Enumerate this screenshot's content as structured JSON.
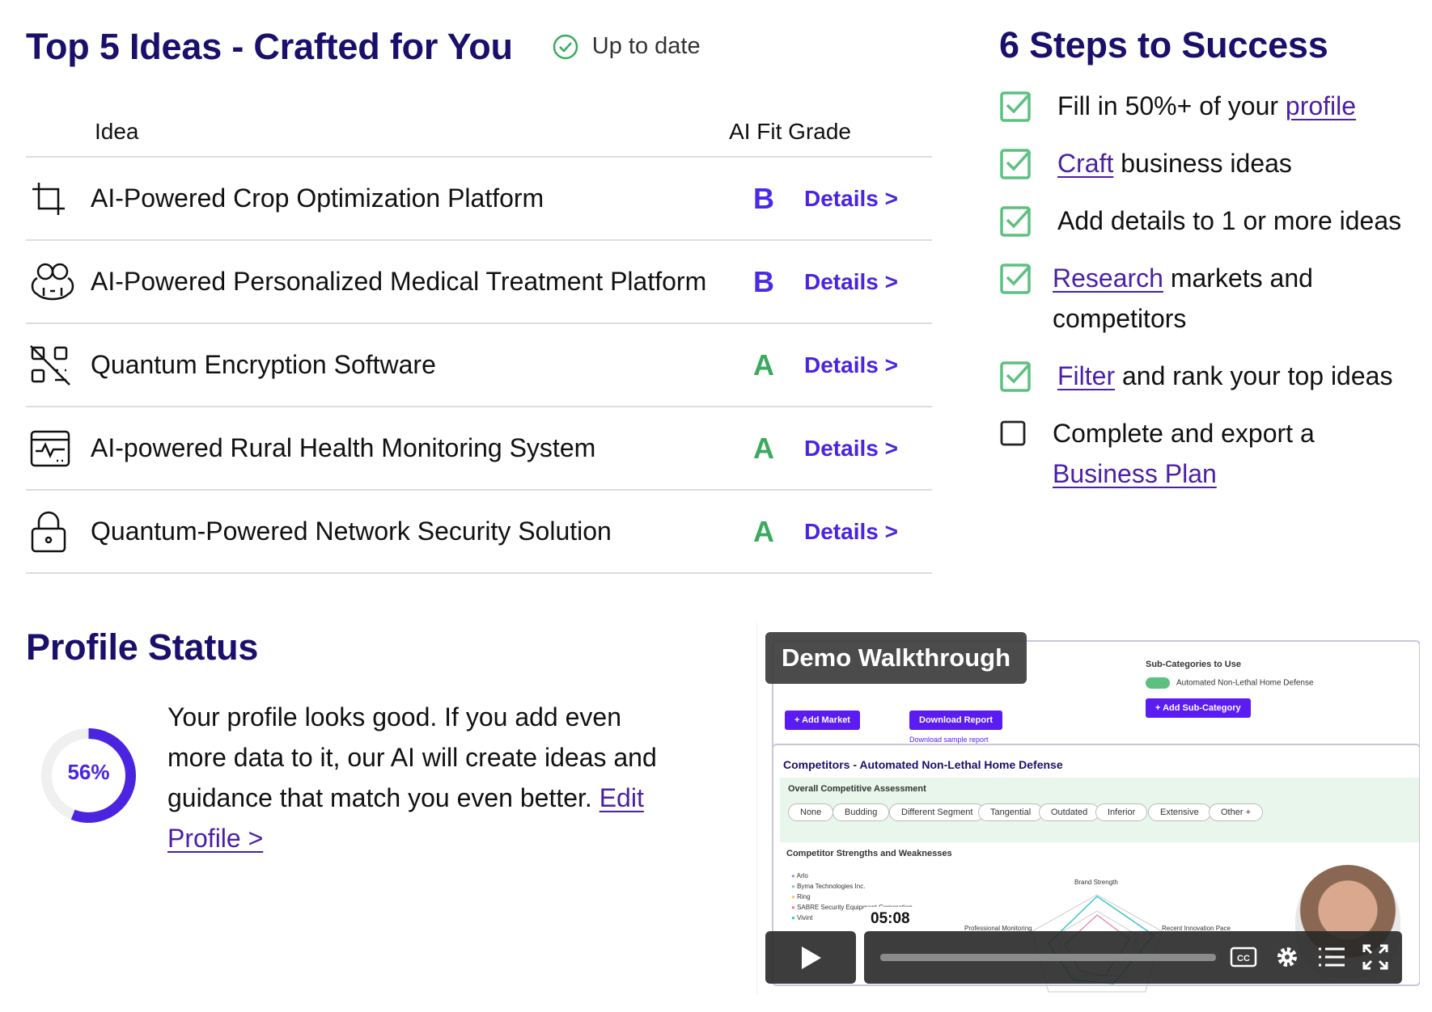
{
  "ideas": {
    "title": "Top 5 Ideas - Crafted for You",
    "status": "Up to date",
    "col_idea": "Idea",
    "col_grade": "AI Fit Grade",
    "rows": [
      {
        "name": "AI-Powered Crop Optimization Platform",
        "grade": "B",
        "details": "Details >",
        "icon": "crop-icon"
      },
      {
        "name": "AI-Powered Personalized Medical Treatment Platform",
        "grade": "B",
        "details": "Details >",
        "icon": "medical-mask-icon"
      },
      {
        "name": "Quantum Encryption Software",
        "grade": "A",
        "details": "Details >",
        "icon": "qr-off-icon"
      },
      {
        "name": "AI-powered Rural Health Monitoring System",
        "grade": "A",
        "details": "Details >",
        "icon": "health-monitor-icon"
      },
      {
        "name": "Quantum-Powered Network Security Solution",
        "grade": "A",
        "details": "Details >",
        "icon": "lock-icon"
      }
    ]
  },
  "steps": {
    "title": "6 Steps to Success",
    "s1_pre": "Fill in 50%+ of your ",
    "s1_link": "profile",
    "s2_link": "Craft",
    "s2_post": " business ideas",
    "s3": "Add details to 1 or more ideas",
    "s4_link": "Research",
    "s4_post": " markets and competitors",
    "s5_link": "Filter",
    "s5_post": " and rank your top ideas",
    "s6_pre": "Complete and export a ",
    "s6_link": "Business Plan"
  },
  "profile": {
    "title": "Profile Status",
    "percent_label": "56%",
    "percent": 56,
    "text": "Your profile looks good. If you add even more data to it, our AI will create ideas and guidance that match you even better. ",
    "link": "Edit Profile >"
  },
  "video": {
    "label": "Demo Walkthrough",
    "time": "05:08",
    "sub_categories": "Sub-Categories to Use",
    "toggle_label": "Automated Non-Lethal Home Defense",
    "add_sub": "+ Add Sub-Category",
    "add_market": "+ Add Market",
    "download": "Download Report",
    "download_sample": "Download sample report",
    "competitors_title": "Competitors - Automated Non-Lethal Home Defense",
    "overall": "Overall Competitive Assessment",
    "pills": [
      "None",
      "Budding",
      "Different Segment",
      "Tangential",
      "Outdated",
      "Inferior",
      "Extensive",
      "Other +"
    ],
    "strengths": "Competitor Strengths and Weaknesses",
    "legend": [
      "Arlo",
      "Byma Technologies Inc.",
      "Ring",
      "SABRE Security Equipment Corporation",
      "Vivint"
    ],
    "radar_labels": [
      "Brand Strength",
      "Professional Monitoring",
      "Recent Innovation Pace"
    ]
  }
}
